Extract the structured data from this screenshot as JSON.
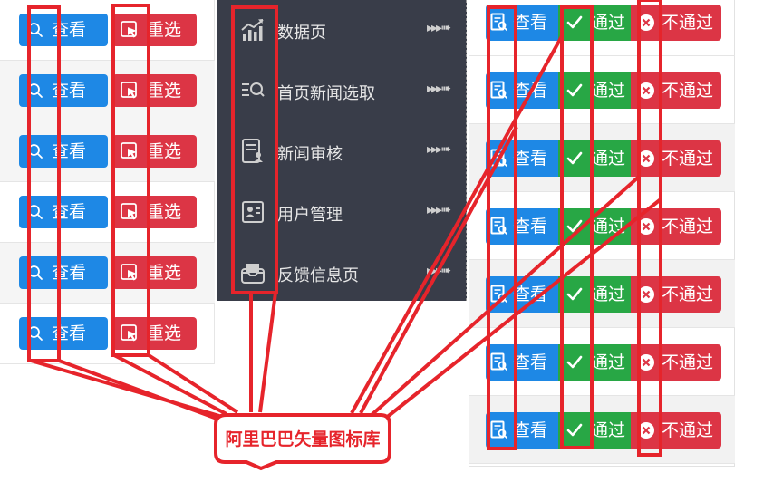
{
  "left_table": {
    "rows": [
      {
        "view_label": "查看",
        "reselect_label": "重选"
      },
      {
        "view_label": "查看",
        "reselect_label": "重选"
      },
      {
        "view_label": "查看",
        "reselect_label": "重选"
      },
      {
        "view_label": "查看",
        "reselect_label": "重选"
      },
      {
        "view_label": "查看",
        "reselect_label": "重选"
      },
      {
        "view_label": "查看",
        "reselect_label": "重选"
      }
    ]
  },
  "sidebar": {
    "items": [
      {
        "label": "数据页",
        "icon": "chart-trend-icon",
        "arrow": "▸▸▸➠"
      },
      {
        "label": "首页新闻选取",
        "icon": "list-search-icon",
        "arrow": "▸▸▸➠"
      },
      {
        "label": "新闻审核",
        "icon": "document-user-icon",
        "arrow": "▸▸▸➠"
      },
      {
        "label": "用户管理",
        "icon": "id-card-icon",
        "arrow": "▸▸▸➠"
      },
      {
        "label": "反馈信息页",
        "icon": "inbox-tray-icon",
        "arrow": "▸▸▸➠"
      }
    ]
  },
  "right_table": {
    "rows": [
      {
        "view_label": "查看",
        "pass_label": "通过",
        "fail_label": "不通过"
      },
      {
        "view_label": "查看",
        "pass_label": "通过",
        "fail_label": "不通过"
      },
      {
        "view_label": "查看",
        "pass_label": "通过",
        "fail_label": "不通过"
      },
      {
        "view_label": "查看",
        "pass_label": "通过",
        "fail_label": "不通过"
      },
      {
        "view_label": "查看",
        "pass_label": "通过",
        "fail_label": "不通过"
      },
      {
        "view_label": "查看",
        "pass_label": "通过",
        "fail_label": "不通过"
      },
      {
        "view_label": "查看",
        "pass_label": "通过",
        "fail_label": "不通过"
      }
    ]
  },
  "annotation": {
    "callout_text": "阿里巴巴矢量图标库"
  },
  "colors": {
    "primary_blue": "#1e88e5",
    "danger_red": "#dc3545",
    "success_green": "#28a745",
    "sidebar_bg": "#393d49",
    "annotation_red": "#e6242b"
  }
}
